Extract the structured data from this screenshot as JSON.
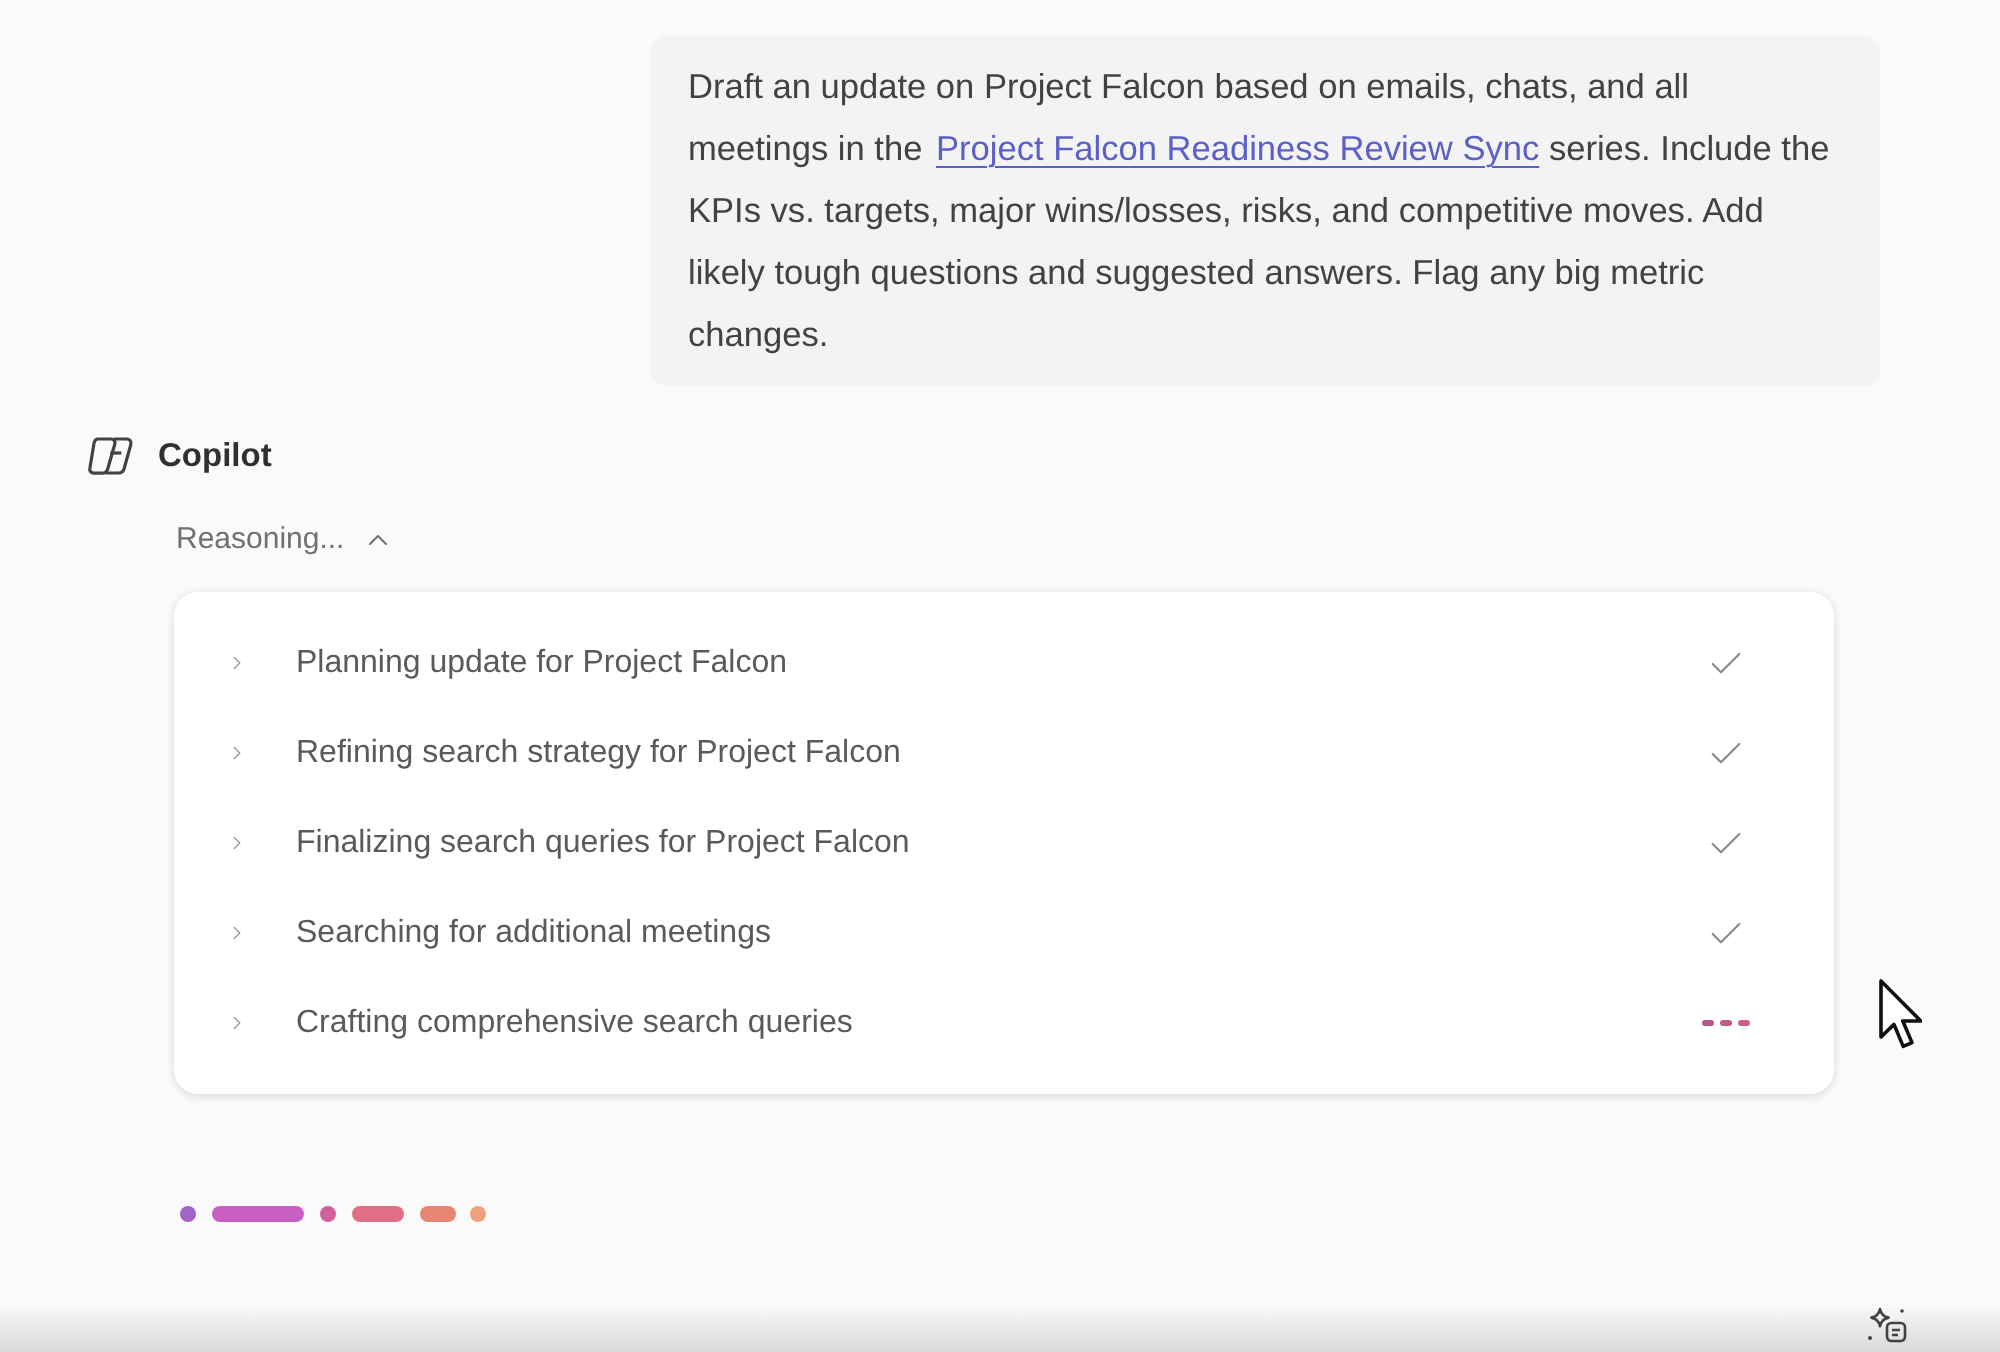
{
  "prompt": {
    "text_before": "Draft an update on Project Falcon based on emails, chats, and all meetings in the",
    "link": "Project Falcon Readiness Review Sync",
    "text_after": "series. Include the KPIs vs. targets, major wins/losses, risks, and competitive moves. Add likely tough questions and suggested answers. Flag any big metric changes."
  },
  "assistant": {
    "name": "Copilot"
  },
  "reasoning": {
    "label": "Reasoning...",
    "expanded": true,
    "steps": [
      {
        "label": "Planning update for Project Falcon",
        "done": true
      },
      {
        "label": "Refining search strategy for Project Falcon",
        "done": true
      },
      {
        "label": "Finalizing search queries for Project Falcon",
        "done": true
      },
      {
        "label": "Searching for additional meetings",
        "done": true
      },
      {
        "label": "Crafting comprehensive search queries",
        "done": false
      }
    ]
  }
}
